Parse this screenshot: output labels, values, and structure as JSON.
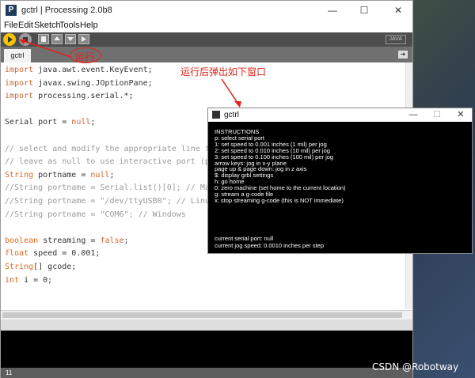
{
  "window": {
    "title": "gctrl | Processing 2.0b8"
  },
  "menu": [
    "File",
    "Edit",
    "Sketch",
    "Tools",
    "Help"
  ],
  "toolbar": {
    "mode": "JAVA"
  },
  "tab": {
    "name": "gctrl"
  },
  "code": [
    [
      [
        "kw",
        "import"
      ],
      [
        "fn",
        " java.awt.event.KeyEvent;"
      ]
    ],
    [
      [
        "kw",
        "import"
      ],
      [
        "fn",
        " javax.swing.JOptionPane;"
      ]
    ],
    [
      [
        "kw",
        "import"
      ],
      [
        "fn",
        " processing.serial.*;"
      ]
    ],
    [],
    [
      [
        "fn",
        "Serial port = "
      ],
      [
        "lit",
        "null"
      ],
      [
        "fn",
        ";"
      ]
    ],
    [],
    [
      [
        "cm",
        "// select and modify the appropriate line for you"
      ]
    ],
    [
      [
        "cm",
        "// leave as null to use interactive port (press"
      ]
    ],
    [
      [
        "ty",
        "String"
      ],
      [
        "fn",
        " portname = "
      ],
      [
        "lit",
        "null"
      ],
      [
        "fn",
        ";"
      ]
    ],
    [
      [
        "cm",
        "//String portname = Serial.list()[0]; // Mac OS X"
      ]
    ],
    [
      [
        "cm",
        "//String portname = \"/dev/ttyUSB0\"; // Linux"
      ]
    ],
    [
      [
        "cm",
        "//String portname = \"COM6\"; // Windows"
      ]
    ],
    [],
    [
      [
        "ty",
        "boolean"
      ],
      [
        "fn",
        " streaming = "
      ],
      [
        "lit",
        "false"
      ],
      [
        "fn",
        ";"
      ]
    ],
    [
      [
        "ty",
        "float"
      ],
      [
        "fn",
        " speed = 0.001;"
      ]
    ],
    [
      [
        "ty",
        "String"
      ],
      [
        "fn",
        "[] gcode;"
      ]
    ],
    [
      [
        "ty",
        "int"
      ],
      [
        "fn",
        " i = 0;"
      ]
    ]
  ],
  "linebar": {
    "line": "11"
  },
  "annotations": {
    "run": "运行",
    "popup": "运行后弹出如下窗口"
  },
  "popup": {
    "title": "gctrl",
    "instructions": [
      "INSTRUCTIONS",
      "p: select serial port",
      "1: set speed to 0.001 inches (1 mil) per jog",
      "2: set speed to 0.010 inches (10 mil) per jog",
      "3: set speed to 0.100 inches (100 mil) per jog",
      "arrow keys: jog in x-y plane",
      "page up & page down: jog in z axis",
      "$: display grbl settings",
      "h: go home",
      "0: zero machine (set home to the current location)",
      "g: stream a g-code file",
      "x: stop streaming g-code (this is NOT immediate)"
    ],
    "status": [
      "current serial port: null",
      "current jog speed: 0.0010 inches per step"
    ]
  },
  "watermark": "CSDN @Robotway",
  "colors": {
    "toolbar": "#4d4d4d",
    "run_button": "#f5c400",
    "annotation": "#e2231a"
  }
}
